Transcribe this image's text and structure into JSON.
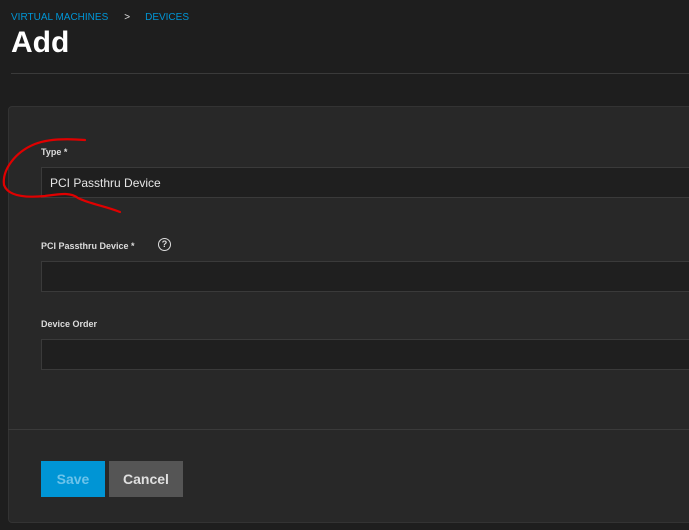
{
  "breadcrumb": {
    "items": [
      "VIRTUAL MACHINES",
      "DEVICES"
    ],
    "separator": ">"
  },
  "page_title": "Add",
  "form": {
    "type": {
      "label": "Type *",
      "value": "PCI Passthru Device"
    },
    "pci_device": {
      "label": "PCI Passthru Device *",
      "value": "",
      "help_icon": "?"
    },
    "device_order": {
      "label": "Device Order",
      "value": ""
    }
  },
  "actions": {
    "save_label": "Save",
    "cancel_label": "Cancel"
  },
  "colors": {
    "accent": "#0095d5",
    "annotation": "#e00000"
  }
}
